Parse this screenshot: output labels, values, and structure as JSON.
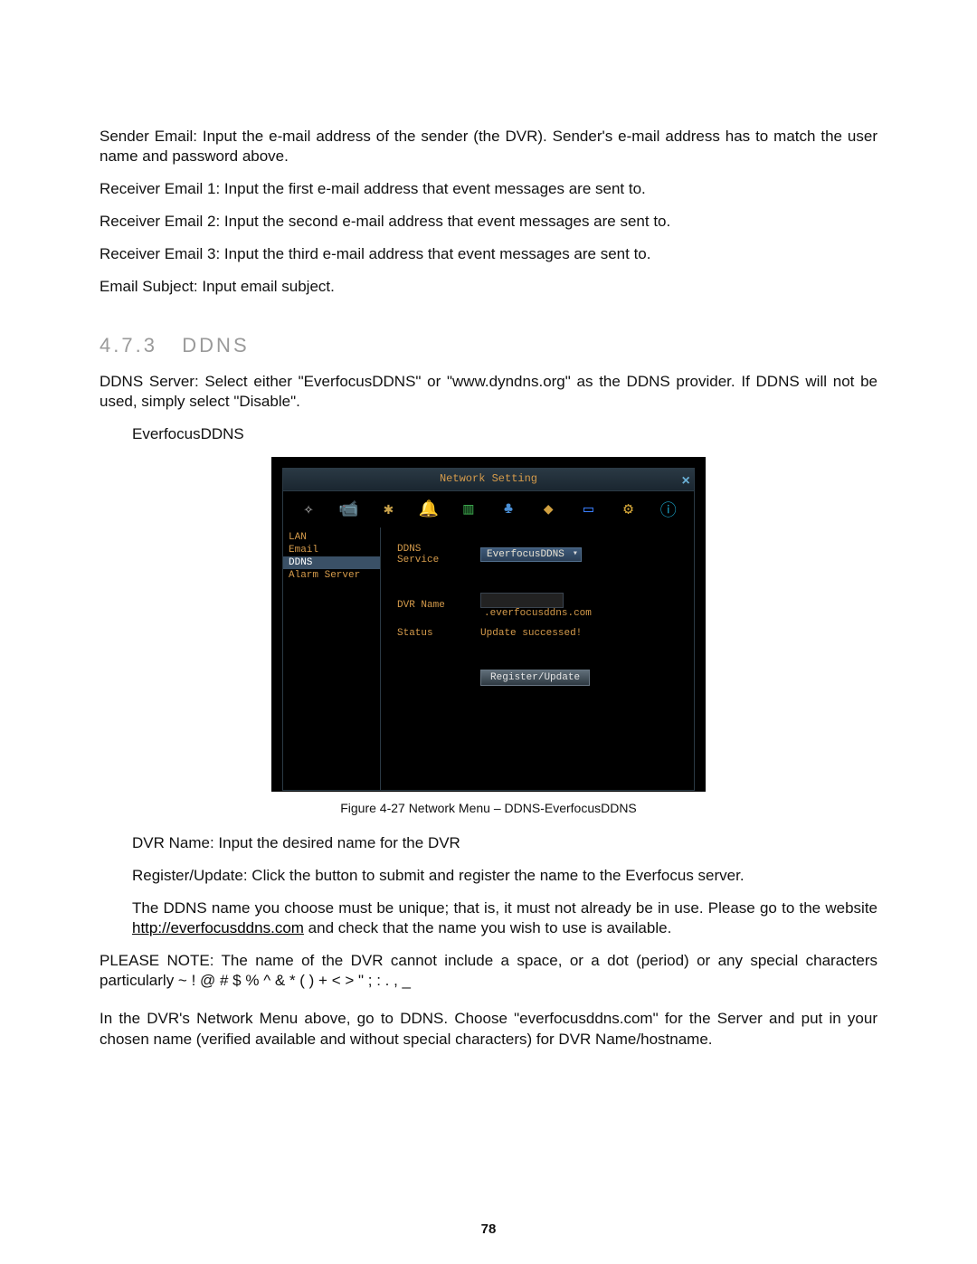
{
  "paras": {
    "p1": "Sender Email: Input the e-mail address of the sender (the DVR). Sender's e-mail address has to match the user name and password above.",
    "p2": "Receiver Email 1: Input the first e-mail address that event messages are sent to.",
    "p3": "Receiver Email 2: Input the second e-mail address that event messages are sent to.",
    "p4": "Receiver Email 3: Input the third e-mail address that event messages are sent to.",
    "p5": "Email Subject: Input email subject.",
    "section_no": "4.7.3",
    "section_title": "DDNS",
    "p6": "DDNS Server: Select either \"EverfocusDDNS\" or \"www.dyndns.org\" as the DDNS provider. If DDNS will not be used, simply select \"Disable\".",
    "p7": "EverfocusDDNS",
    "caption": "Figure 4-27  Network Menu – DDNS-EverfocusDDNS",
    "p8": "DVR Name: Input the desired name for the DVR",
    "p9": "Register/Update: Click the button to submit and register the name to the Everfocus server.",
    "p10a": "The DDNS name you choose must be unique; that is, it must not already be in use. Please go to the website ",
    "p10link": "http://everfocusddns.com",
    "p10b": " and check that the name you wish to use is available.",
    "p11": "PLEASE NOTE: The name of the DVR cannot include a space, or a dot (period) or any special characters particularly ~ ! @ # $ % ^ & * ( ) + < > \" ; : . , _",
    "p12": "In the DVR's Network Menu above, go to DDNS. Choose \"everfocusddns.com\" for the Server and put in your chosen name (verified available and without special characters) for DVR Name/hostname.",
    "page_num": "78"
  },
  "ui": {
    "title": "Network Setting",
    "sidebar": [
      "LAN",
      "Email",
      "DDNS",
      "Alarm Server"
    ],
    "sidebar_selected": 2,
    "fields": {
      "ddns_label": "DDNS Service",
      "ddns_value": "EverfocusDDNS",
      "dvr_label": "DVR Name",
      "dvr_suffix": ".everfocusddns.com",
      "status_label": "Status",
      "status_value": "Update successed!",
      "button": "Register/Update"
    },
    "icons": [
      "magic",
      "camera",
      "reel",
      "bell",
      "schedule",
      "network",
      "disk",
      "display",
      "gear",
      "info"
    ]
  }
}
